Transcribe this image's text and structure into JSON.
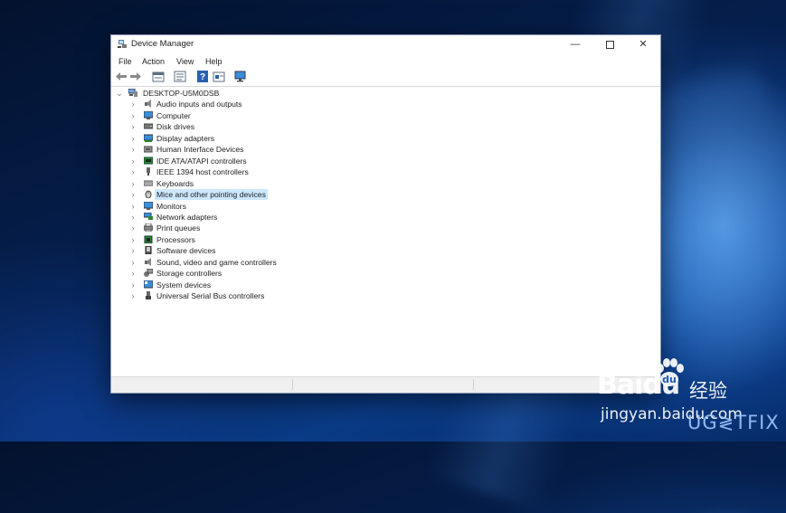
{
  "window": {
    "title": "Device Manager",
    "controls": {
      "minimize": "—",
      "close": "✕"
    }
  },
  "menu": [
    "File",
    "Action",
    "View",
    "Help"
  ],
  "tree": {
    "root": "DESKTOP-U5M0DSB",
    "items": [
      {
        "label": "Audio inputs and outputs",
        "icon": "speaker-icon"
      },
      {
        "label": "Computer",
        "icon": "computer-icon"
      },
      {
        "label": "Disk drives",
        "icon": "disk-drive-icon"
      },
      {
        "label": "Display adapters",
        "icon": "display-adapter-icon"
      },
      {
        "label": "Human Interface Devices",
        "icon": "hid-icon"
      },
      {
        "label": "IDE ATA/ATAPI controllers",
        "icon": "ide-controller-icon"
      },
      {
        "label": "IEEE 1394 host controllers",
        "icon": "ieee1394-icon"
      },
      {
        "label": "Keyboards",
        "icon": "keyboard-icon"
      },
      {
        "label": "Mice and other pointing devices",
        "icon": "mouse-icon",
        "selected": true
      },
      {
        "label": "Monitors",
        "icon": "monitor-icon"
      },
      {
        "label": "Network adapters",
        "icon": "network-adapter-icon"
      },
      {
        "label": "Print queues",
        "icon": "printer-icon"
      },
      {
        "label": "Processors",
        "icon": "processor-icon"
      },
      {
        "label": "Software devices",
        "icon": "software-device-icon"
      },
      {
        "label": "Sound, video and game controllers",
        "icon": "sound-icon"
      },
      {
        "label": "Storage controllers",
        "icon": "storage-controller-icon"
      },
      {
        "label": "System devices",
        "icon": "system-devices-icon"
      },
      {
        "label": "Universal Serial Bus controllers",
        "icon": "usb-icon"
      }
    ]
  },
  "watermark": {
    "baidu": "Baidu",
    "cn": "经验",
    "url": "jingyan.baidu.com",
    "ugetfix": "UG≷TFIX"
  },
  "colors": {
    "selection": "#cce8ff",
    "accent": "#0078d7"
  }
}
